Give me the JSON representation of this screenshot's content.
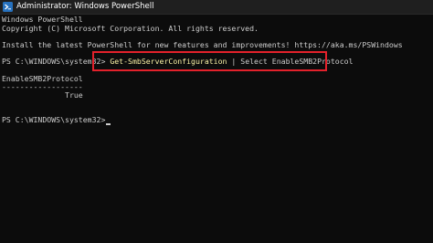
{
  "window": {
    "title": "Administrator: Windows PowerShell",
    "icon": "powershell-icon",
    "accent_color": "#e3212b"
  },
  "console": {
    "banner_line1": "Windows PowerShell",
    "banner_line2": "Copyright (C) Microsoft Corporation. All rights reserved.",
    "banner_line3": "Install the latest PowerShell for new features and improvements! https://aka.ms/PSWindows",
    "prompt1": "PS C:\\WINDOWS\\system32> ",
    "command_cmdlet": "Get-SmbServerConfiguration",
    "command_rest": " | Select EnableSMB2Protocol",
    "output_header": "EnableSMB2Protocol",
    "output_rule": "------------------",
    "output_value": "              True",
    "prompt2": "PS C:\\WINDOWS\\system32>"
  }
}
